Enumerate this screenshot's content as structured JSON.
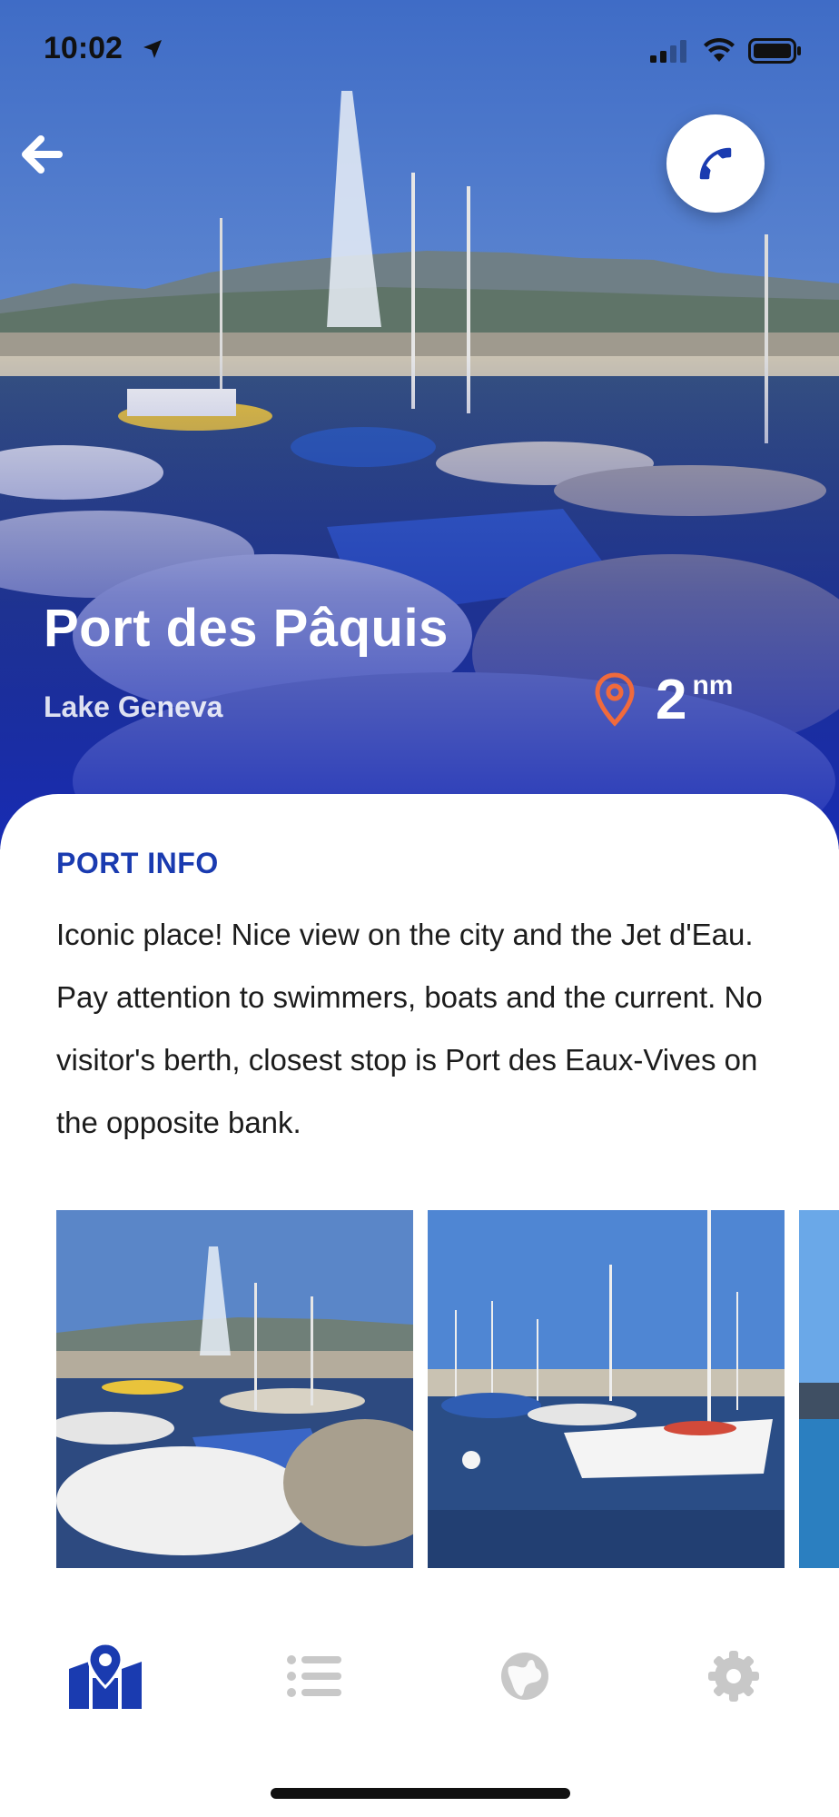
{
  "status_bar": {
    "time": "10:02"
  },
  "header": {
    "back_icon": "arrow-left-icon",
    "call_icon": "phone-icon"
  },
  "port": {
    "name": "Port des Pâquis",
    "lake": "Lake Geneva",
    "distance_value": "2",
    "distance_unit": "nm",
    "location_icon": "map-pin-icon"
  },
  "port_info": {
    "heading": "PORT INFO",
    "description": "Iconic place! Nice view on the city and the Jet d'Eau. Pay attention to swimmers, boats and the current. No visitor's berth, closest stop is Port des Eaux-Vives on the opposite bank."
  },
  "tab_bar": {
    "tabs": [
      {
        "icon": "map-icon",
        "active": true
      },
      {
        "icon": "list-icon",
        "active": false
      },
      {
        "icon": "globe-icon",
        "active": false
      },
      {
        "icon": "gear-icon",
        "active": false
      }
    ]
  },
  "colors": {
    "accent": "#1a3bb0",
    "pin": "#f06a3c",
    "inactive_tab": "#c8c8c8"
  }
}
